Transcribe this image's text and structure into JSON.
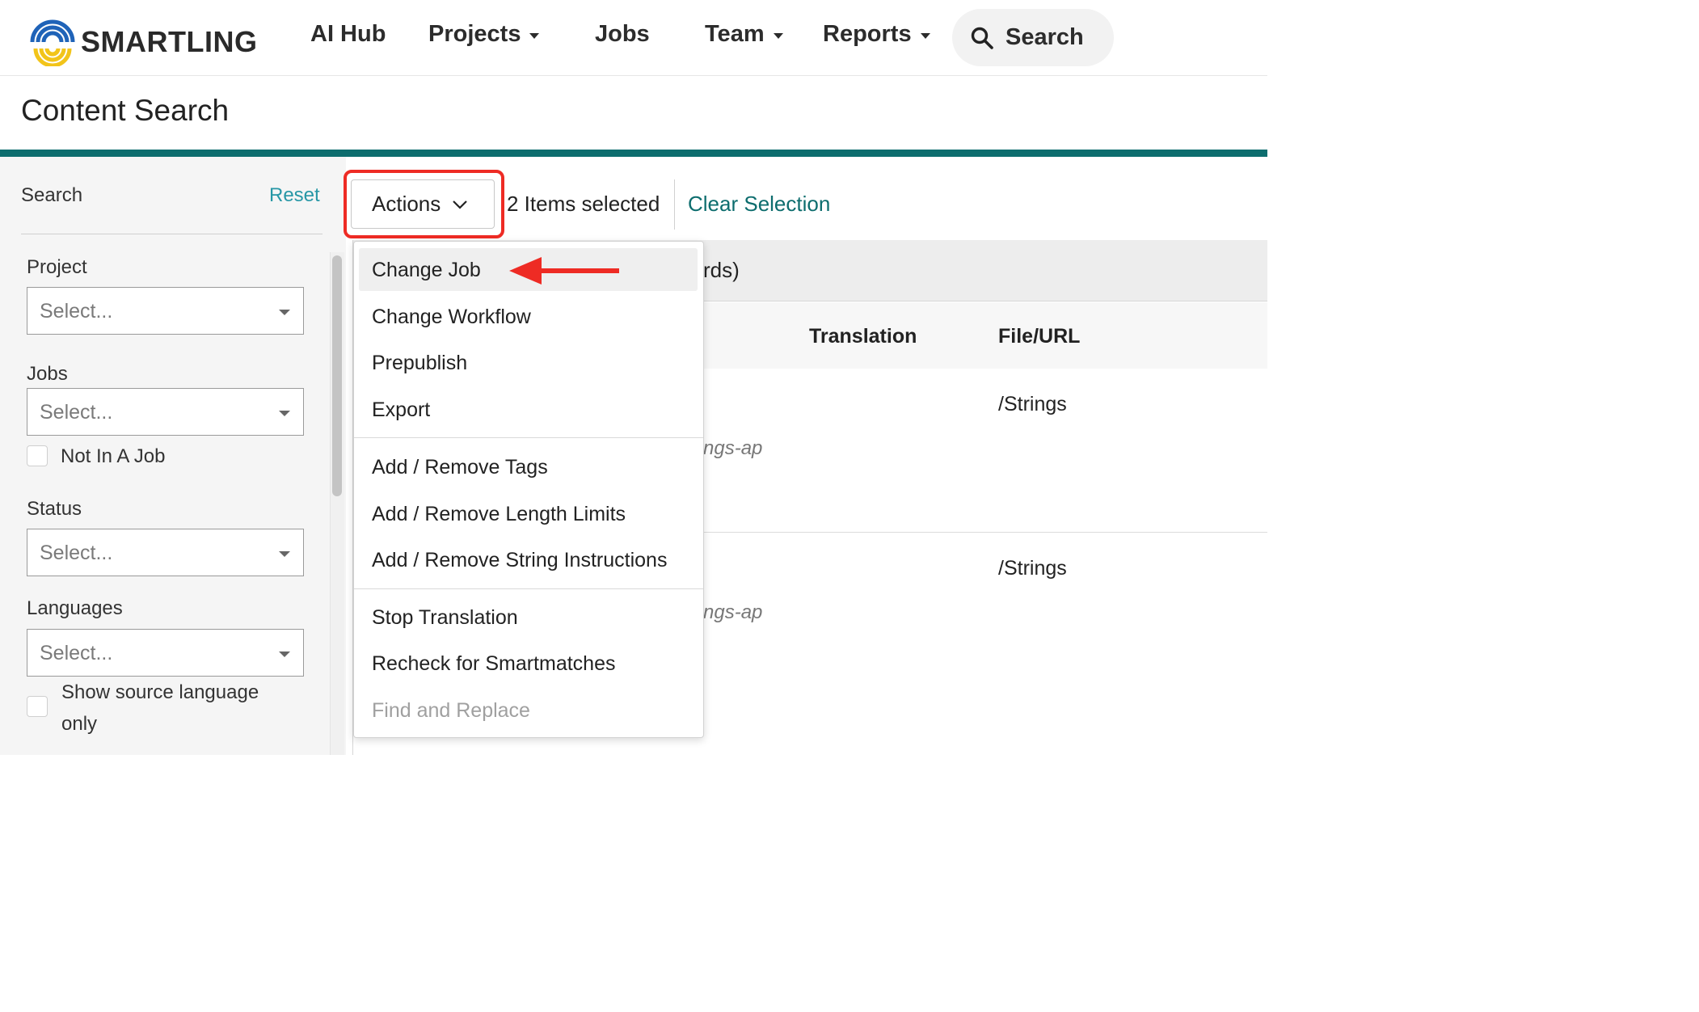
{
  "brand": {
    "name": "SMARTLING"
  },
  "nav": {
    "ai_hub": "AI Hub",
    "projects": "Projects",
    "jobs": "Jobs",
    "team": "Team",
    "reports": "Reports",
    "search": "Search"
  },
  "page": {
    "title": "Content Search"
  },
  "sidebar": {
    "search_label": "Search",
    "reset_label": "Reset",
    "project_label": "Project",
    "project_placeholder": "Select...",
    "jobs_label": "Jobs",
    "jobs_placeholder": "Select...",
    "not_in_job_label": "Not In A Job",
    "status_label": "Status",
    "status_placeholder": "Select...",
    "languages_label": "Languages",
    "languages_placeholder": "Select...",
    "show_source_line1": "Show source language",
    "show_source_line2": "only"
  },
  "toolbar": {
    "actions_label": "Actions",
    "items_selected": "2 Items selected",
    "clear_selection": "Clear Selection"
  },
  "table": {
    "band_text_fragment": "rds)",
    "col_translation": "Translation",
    "col_file_url": "File/URL",
    "rows": [
      {
        "file": "/Strings",
        "path_fragment": "ngs-ap"
      },
      {
        "file": "/Strings",
        "path_fragment": "ngs-ap"
      }
    ]
  },
  "actions_menu": {
    "items": [
      "Change Job",
      "Change Workflow",
      "Prepublish",
      "Export",
      "Add / Remove Tags",
      "Add / Remove Length Limits",
      "Add / Remove String Instructions",
      "Stop Translation",
      "Recheck for Smartmatches",
      "Find and Replace"
    ],
    "disabled_item": "Find and Replace",
    "highlighted_item": "Change Job"
  },
  "colors": {
    "accent_teal": "#0d6d6e",
    "link_teal": "#2797a6",
    "annotation_red": "#ee2b24"
  }
}
